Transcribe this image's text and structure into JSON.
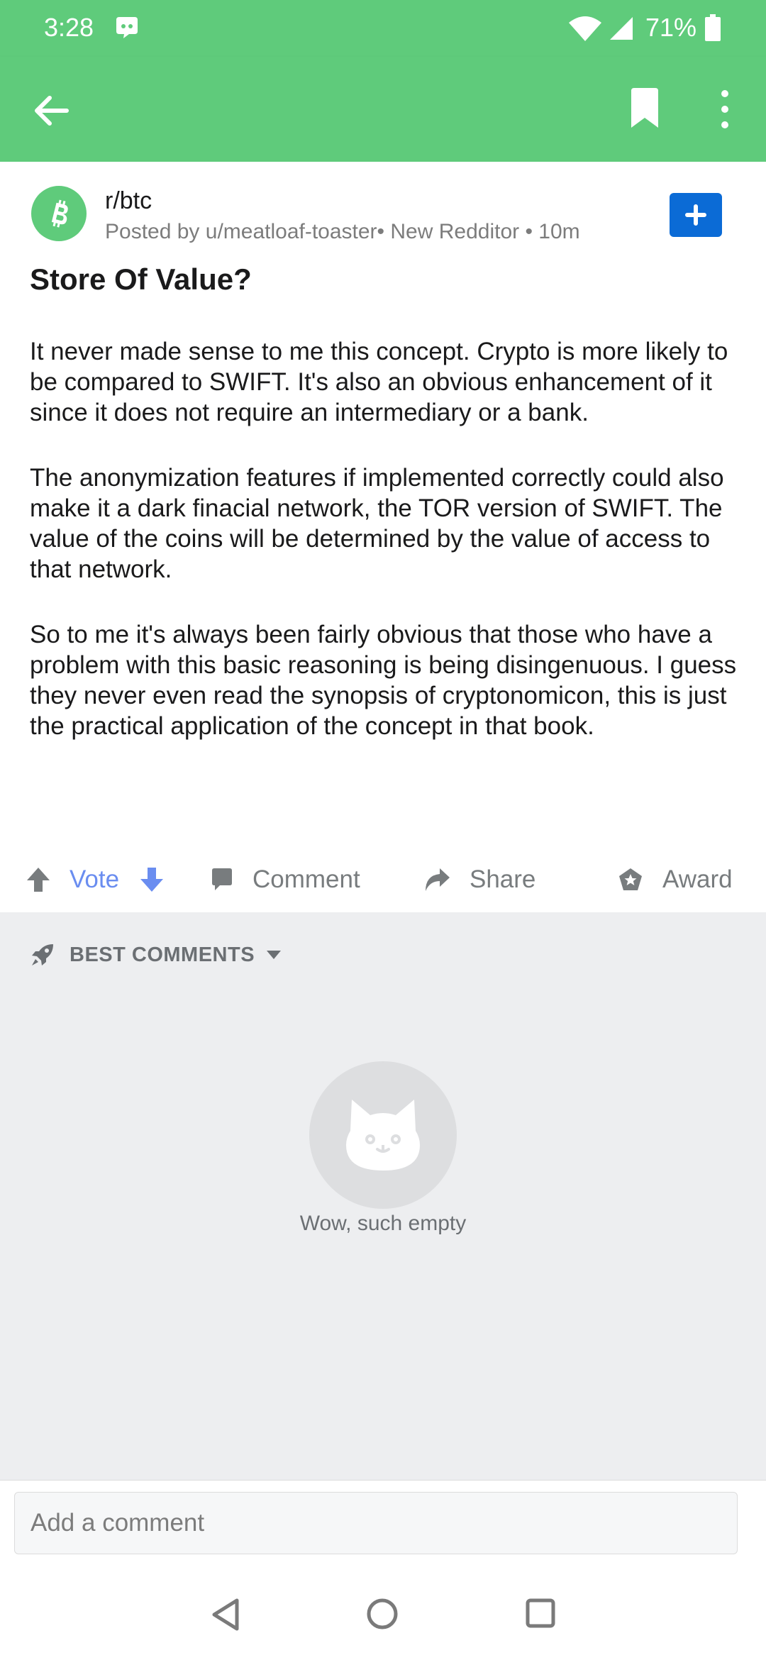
{
  "status_bar": {
    "time": "3:28",
    "battery": "71%"
  },
  "app_bar": {
    "back_icon": "arrow-left-icon",
    "bookmark_icon": "bookmark-icon",
    "more_icon": "more-vertical-icon"
  },
  "post": {
    "subreddit": "r/btc",
    "meta": "Posted by u/meatloaf-toaster• New Redditor • 10m",
    "title": "Store Of Value?",
    "paragraphs": [
      "It never made sense to me this concept. Crypto is more likely to be compared to SWIFT. It's also an obvious enhancement of it since it does not require an intermediary or a bank.",
      "The anonymization features if implemented correctly could also make it a dark finacial network, the TOR version of SWIFT. The value of the coins will be determined by the value of access to that network.",
      "So to me it's always been fairly obvious that those who have a problem with this basic reasoning is being disingenuous. I guess they never even read the synopsis of cryptonomicon, this is just the practical application of the concept in that book."
    ]
  },
  "actions": {
    "vote_label": "Vote",
    "comment_label": "Comment",
    "share_label": "Share",
    "award_label": "Award"
  },
  "comments": {
    "sort_label": "BEST COMMENTS",
    "empty_text": "Wow, such empty"
  },
  "comment_input": {
    "placeholder": "Add a comment"
  },
  "colors": {
    "brand_green": "#5fcb7b",
    "join_blue": "#0b6bd6",
    "vote_blue": "#6a8df0",
    "muted_gray": "#787c7e",
    "comments_bg": "#edeef0"
  }
}
